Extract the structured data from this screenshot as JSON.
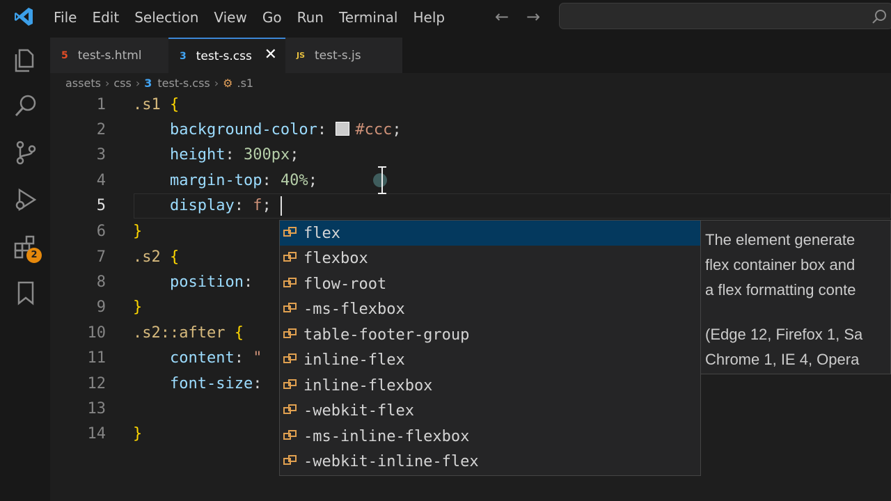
{
  "menu": [
    "File",
    "Edit",
    "Selection",
    "View",
    "Go",
    "Run",
    "Terminal",
    "Help"
  ],
  "nav": {
    "back_icon": "arrow-left-icon",
    "forward_icon": "arrow-right-icon"
  },
  "activity": {
    "extensions_badge": "2"
  },
  "tabs": [
    {
      "label": "test-s.html",
      "icon": "5",
      "icon_color": "#e44d26"
    },
    {
      "label": "test-s.css",
      "icon": "3",
      "icon_color": "#42a5f5"
    },
    {
      "label": "test-s.js",
      "icon": "JS",
      "icon_color": "#e8c03f"
    }
  ],
  "breadcrumb": [
    "assets",
    "css",
    "test-s.css",
    ".s1"
  ],
  "editor": {
    "line_numbers": [
      "1",
      "2",
      "3",
      "4",
      "5",
      "6",
      "7",
      "8",
      "9",
      "10",
      "11",
      "12",
      "13",
      "14"
    ],
    "current_line": "5",
    "lines": {
      "l1": {
        "sel": ".s1",
        "brace": "{"
      },
      "l2": {
        "prop": "background-color",
        "value": "#ccc"
      },
      "l3": {
        "prop": "height",
        "value": "300px"
      },
      "l4": {
        "prop": "margin-top",
        "value": "40%"
      },
      "l5": {
        "prop": "display",
        "value": "f"
      },
      "l6": {
        "brace": "}"
      },
      "l7": {
        "sel": ".s2",
        "brace": "{"
      },
      "l8": {
        "prop": "position"
      },
      "l9": {
        "brace": "}"
      },
      "l10": {
        "sel": ".s2::after",
        "brace": "{"
      },
      "l11": {
        "prop": "content",
        "value": "\""
      },
      "l12": {
        "prop": "font-size"
      },
      "l14": {
        "brace": "}"
      }
    }
  },
  "suggestions": [
    "flex",
    "flexbox",
    "flow-root",
    "-ms-flexbox",
    "table-footer-group",
    "inline-flex",
    "inline-flexbox",
    "-webkit-flex",
    "-ms-inline-flexbox",
    "-webkit-inline-flex"
  ],
  "details": {
    "line1": "The element generate",
    "line2": "flex container box and",
    "line3": "a flex formatting conte",
    "compat1": "(Edge 12, Firefox 1, Sa",
    "compat2": "Chrome 1, IE 4, Opera"
  },
  "colors": {
    "accent": "#3c87d6",
    "selection": "#04395e",
    "swatch": "#cccccc"
  }
}
